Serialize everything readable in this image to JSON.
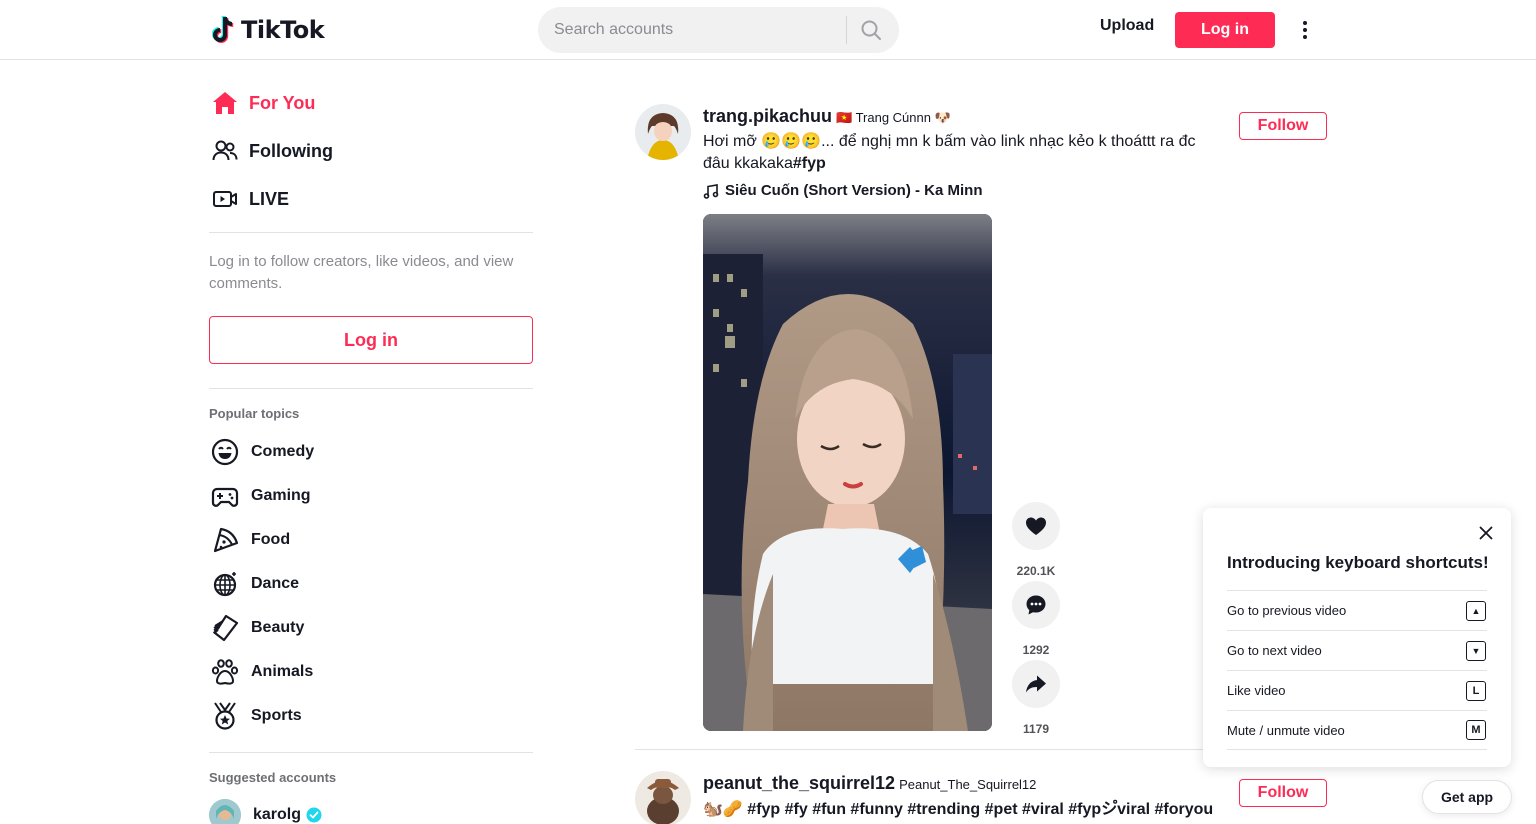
{
  "header": {
    "logo_text": "TikTok",
    "search_placeholder": "Search accounts",
    "upload_label": "Upload",
    "login_label": "Log in"
  },
  "sidebar": {
    "nav": [
      {
        "label": "For You",
        "icon": "home-icon",
        "active": true
      },
      {
        "label": "Following",
        "icon": "people-icon",
        "active": false
      },
      {
        "label": "LIVE",
        "icon": "live-icon",
        "active": false
      }
    ],
    "hint": "Log in to follow creators, like videos, and view comments.",
    "login_label": "Log in",
    "topics_title": "Popular topics",
    "topics": [
      {
        "label": "Comedy",
        "icon": "laugh-icon"
      },
      {
        "label": "Gaming",
        "icon": "gamepad-icon"
      },
      {
        "label": "Food",
        "icon": "pizza-icon"
      },
      {
        "label": "Dance",
        "icon": "disco-ball-icon"
      },
      {
        "label": "Beauty",
        "icon": "comb-icon"
      },
      {
        "label": "Animals",
        "icon": "paw-icon"
      },
      {
        "label": "Sports",
        "icon": "medal-icon"
      }
    ],
    "suggested_title": "Suggested accounts",
    "suggested": [
      {
        "name": "karolg",
        "verified": true
      }
    ]
  },
  "feed": {
    "posts": [
      {
        "username": "trang.pikachuu",
        "nickname": "🇻🇳 Trang Cúnnn 🐶",
        "caption": "Hơi mỡ 🥲🥲🥲... để nghị mn k bấm vào link nhạc kẻo k thoáttt ra đc đâu kkakaka",
        "hashtag": "#fyp",
        "music": "Siêu Cuốn (Short Version) - Ka Minn",
        "follow_label": "Follow",
        "likes": "220.1K",
        "comments": "1292",
        "shares": "1179"
      },
      {
        "username": "peanut_the_squirrel12",
        "nickname": "Peanut_The_Squirrel12",
        "caption": "🐿️🥜 #fyp #fy #fun #funny #trending #pet #viral #fypシ゚viral #foryou",
        "follow_label": "Follow"
      }
    ]
  },
  "shortcuts": {
    "title": "Introducing keyboard shortcuts!",
    "items": [
      {
        "label": "Go to previous video",
        "key": "▲"
      },
      {
        "label": "Go to next video",
        "key": "▼"
      },
      {
        "label": "Like video",
        "key": "L"
      },
      {
        "label": "Mute / unmute video",
        "key": "M"
      }
    ]
  },
  "get_app_label": "Get app",
  "colors": {
    "brand": "#fe2c55",
    "text": "#161823",
    "muted": "#8a8b91"
  }
}
